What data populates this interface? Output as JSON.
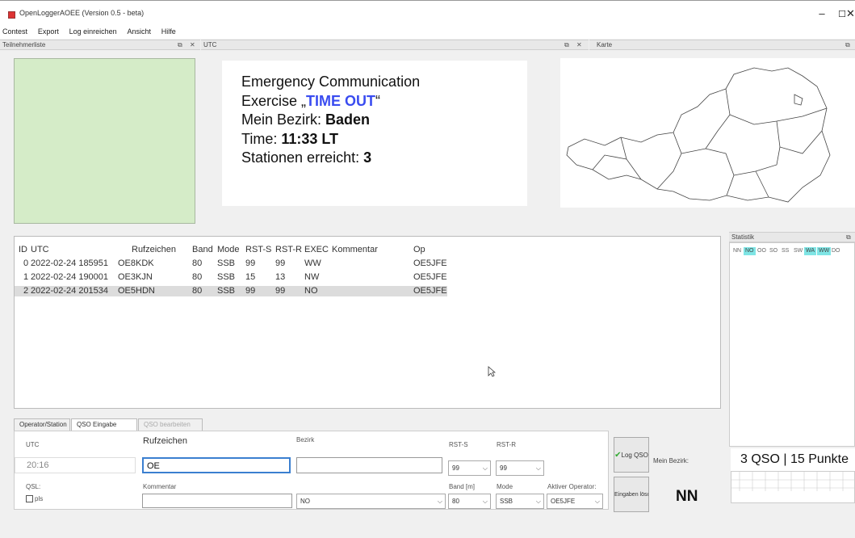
{
  "window": {
    "title": "OpenLoggerAOEE (Version 0.5 - beta)"
  },
  "menu": [
    "Contest",
    "Export",
    "Log einreichen",
    "Ansicht",
    "Hilfe"
  ],
  "docks": {
    "left": "Teilnehmerliste",
    "utc": "UTC",
    "map": "Karte",
    "stats": "Statistik"
  },
  "info": {
    "line1": "Emergency Communication",
    "line2_prefix": "Exercise „",
    "line2_highlight": "TIME OUT",
    "line2_suffix": "“",
    "line3_label": "Mein Bezirk: ",
    "line3_value": "Baden",
    "line4_label": "Time: ",
    "line4_value": "11:33 LT",
    "line5_label": "Stationen erreicht: ",
    "line5_value": "3"
  },
  "table": {
    "headers": [
      "ID",
      "UTC",
      "Rufzeichen",
      "Band",
      "Mode",
      "RST-S",
      "RST-R",
      "EXEC",
      "Kommentar",
      "Op"
    ],
    "rows": [
      [
        "0",
        "2022-02-24 185951",
        "OE8KDK",
        "80",
        "SSB",
        "99",
        "99",
        "WW",
        "",
        "OE5JFE"
      ],
      [
        "1",
        "2022-02-24 190001",
        "OE3KJN",
        "80",
        "SSB",
        "15",
        "13",
        "NW",
        "",
        "OE5JFE"
      ],
      [
        "2",
        "2022-02-24 201534",
        "OE5HDN",
        "80",
        "SSB",
        "99",
        "99",
        "NO",
        "",
        "OE5JFE"
      ]
    ]
  },
  "stats": {
    "districts": [
      "NN",
      "NO",
      "OO",
      "SO",
      "SS",
      "SW",
      "WA",
      "WW",
      "DO"
    ],
    "score": "3 QSO | 15 Punkte"
  },
  "tabs": [
    "Operator/Station",
    "QSO Eingabe",
    "QSO bearbeiten"
  ],
  "form": {
    "utc_label": "UTC",
    "utc_value": "20:16",
    "call_label": "Rufzeichen",
    "call_value": "OE",
    "bezirk_label": "Bezirk",
    "rsts_label": "RST-S",
    "rstr_label": "RST-R",
    "rsts_value": "99",
    "rstr_value": "99",
    "qsl_label": "QSL:",
    "pls_label": "pls",
    "kommentar_label": "Kommentar",
    "exec_value": "NO",
    "band_label": "Band [m]",
    "mode_label": "Mode",
    "op_label": "Aktiver Operator:",
    "band_value": "80",
    "mode_value": "SSB",
    "op_value": "OE5JFE",
    "log_button": "Log QSO",
    "clear_button": "Eingaben löschen",
    "mein_bezirk_label": "Mein Bezirk:",
    "mein_bezirk_value": "NN"
  }
}
